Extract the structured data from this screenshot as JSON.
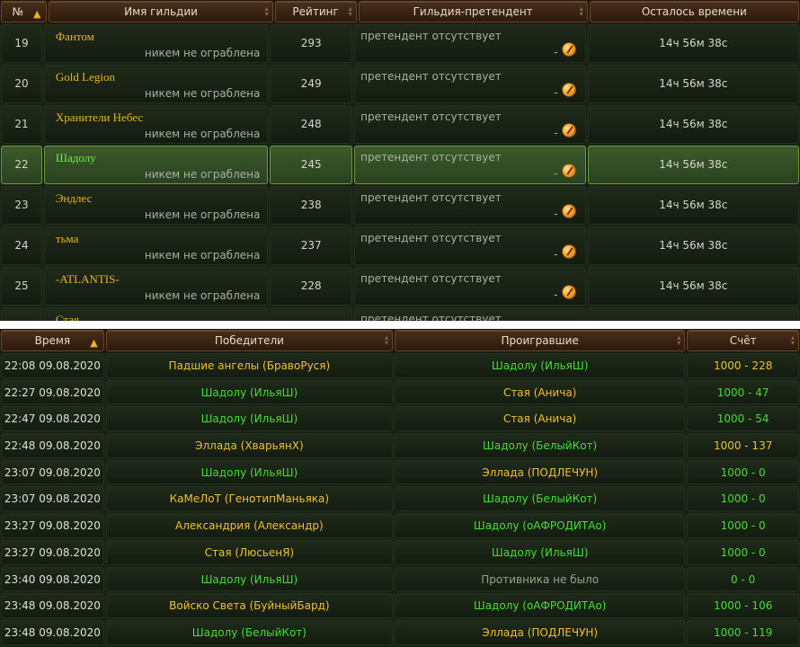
{
  "top": {
    "headers": {
      "num": "№",
      "name": "Имя гильдии",
      "rating": "Рейтинг",
      "pretender": "Гильдия-претендент",
      "time": "Осталось времени"
    },
    "rows": [
      {
        "num": "19",
        "name": "Фантом",
        "status": "никем не ограблена",
        "rating": "293",
        "pretender": "претендент отсутствует",
        "dash": "-",
        "time": "14ч 56м 38с",
        "highlight": false
      },
      {
        "num": "20",
        "name": "Gold Legion",
        "status": "никем не ограблена",
        "rating": "249",
        "pretender": "претендент отсутствует",
        "dash": "-",
        "time": "14ч 56м 38с",
        "highlight": false
      },
      {
        "num": "21",
        "name": "Хранители Небес",
        "status": "никем не ограблена",
        "rating": "248",
        "pretender": "претендент отсутствует",
        "dash": "-",
        "time": "14ч 56м 38с",
        "highlight": false
      },
      {
        "num": "22",
        "name": "Шадолу",
        "status": "никем не ограблена",
        "rating": "245",
        "pretender": "претендент отсутствует",
        "dash": "-",
        "time": "14ч 56м 38с",
        "highlight": true
      },
      {
        "num": "23",
        "name": "Эндлес",
        "status": "никем не ограблена",
        "rating": "238",
        "pretender": "претендент отсутствует",
        "dash": "-",
        "time": "14ч 56м 38с",
        "highlight": false
      },
      {
        "num": "24",
        "name": "тьма",
        "status": "никем не ограблена",
        "rating": "237",
        "pretender": "претендент отсутствует",
        "dash": "-",
        "time": "14ч 56м 38с",
        "highlight": false
      },
      {
        "num": "25",
        "name": "-ATLANTIS-",
        "status": "никем не ограблена",
        "rating": "228",
        "pretender": "претендент отсутствует",
        "dash": "-",
        "time": "14ч 56м 38с",
        "highlight": false
      },
      {
        "num": "",
        "name": "Стая",
        "status": "",
        "rating": "",
        "pretender": "претендент отсутствует",
        "dash": "",
        "time": "",
        "highlight": false
      }
    ]
  },
  "bottom": {
    "headers": {
      "time": "Время",
      "winners": "Победители",
      "losers": "Проигравшие",
      "score": "Счёт"
    },
    "rows": [
      {
        "time": "22:08 09.08.2020",
        "winner": "Падшие ангелы (БравоРуся)",
        "winner_color": "yellow",
        "loser": "Шадолу (ИльяШ)",
        "loser_color": "green",
        "score": "1000 - 228",
        "score_color": "yellow"
      },
      {
        "time": "22:27 09.08.2020",
        "winner": "Шадолу (ИльяШ)",
        "winner_color": "green",
        "loser": "Стая (Анича)",
        "loser_color": "yellow",
        "score": "1000 - 47",
        "score_color": "green"
      },
      {
        "time": "22:47 09.08.2020",
        "winner": "Шадолу (ИльяШ)",
        "winner_color": "green",
        "loser": "Стая (Анича)",
        "loser_color": "yellow",
        "score": "1000 - 54",
        "score_color": "green"
      },
      {
        "time": "22:48 09.08.2020",
        "winner": "Эллада (ХварьянХ)",
        "winner_color": "yellow",
        "loser": "Шадолу (БелыйКот)",
        "loser_color": "green",
        "score": "1000 - 137",
        "score_color": "yellow"
      },
      {
        "time": "23:07 09.08.2020",
        "winner": "Шадолу (ИльяШ)",
        "winner_color": "green",
        "loser": "Эллада (ПОДЛЕЧУН)",
        "loser_color": "yellow",
        "score": "1000 - 0",
        "score_color": "green"
      },
      {
        "time": "23:07 09.08.2020",
        "winner": "КаМеЛоТ (ГенотипМаньяка)",
        "winner_color": "yellow",
        "loser": "Шадолу (БелыйКот)",
        "loser_color": "green",
        "score": "1000 - 0",
        "score_color": "green"
      },
      {
        "time": "23:27 09.08.2020",
        "winner": "Александрия (Александр)",
        "winner_color": "yellow",
        "loser": "Шадолу (оАФРОДИТАо)",
        "loser_color": "green",
        "score": "1000 - 0",
        "score_color": "green"
      },
      {
        "time": "23:27 09.08.2020",
        "winner": "Стая (ЛюсьенЯ)",
        "winner_color": "yellow",
        "loser": "Шадолу (ИльяШ)",
        "loser_color": "green",
        "score": "1000 - 0",
        "score_color": "green"
      },
      {
        "time": "23:40 09.08.2020",
        "winner": "Шадолу (ИльяШ)",
        "winner_color": "green",
        "loser": "Противника не было",
        "loser_color": "grey",
        "score": "0 - 0",
        "score_color": "green"
      },
      {
        "time": "23:48 09.08.2020",
        "winner": "Войско Света (БуйныйБард)",
        "winner_color": "yellow",
        "loser": "Шадолу (оАФРОДИТАо)",
        "loser_color": "green",
        "score": "1000 - 106",
        "score_color": "green"
      },
      {
        "time": "23:48 09.08.2020",
        "winner": "Шадолу (БелыйКот)",
        "winner_color": "green",
        "loser": "Эллада (ПОДЛЕЧУН)",
        "loser_color": "yellow",
        "score": "1000 - 119",
        "score_color": "green"
      }
    ]
  },
  "icons": {
    "sort_active": "sort-arrow-up-icon",
    "sort_inactive": "sort-arrows-icon",
    "coin": "attack-coin-icon"
  }
}
